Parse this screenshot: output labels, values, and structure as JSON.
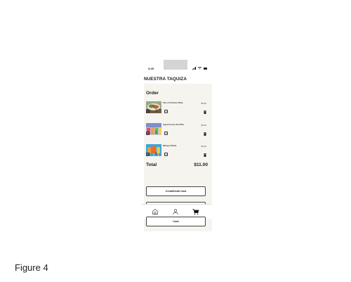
{
  "status_bar": {
    "time": "9:45"
  },
  "app": {
    "title": "NUESTRA TAQUIZA"
  },
  "order": {
    "heading": "Order",
    "items": [
      {
        "name": "Taco Al Pastor Plate",
        "price": "$6.00",
        "quantity": "1",
        "minus": "−",
        "plus": "+"
      },
      {
        "name": "Agua Fresca De Piña",
        "price": "$3.00",
        "quantity": "1",
        "minus": "−",
        "plus": "+"
      },
      {
        "name": "Mango Paleta",
        "price": "$2.00",
        "quantity": "1",
        "minus": "−",
        "plus": "+"
      }
    ],
    "total_label": "Total",
    "total_value": "$11.00"
  },
  "payment": {
    "card_label": "Credit/Debit Card",
    "cash_label": "Cash"
  },
  "tabbar": {
    "items": [
      "home-icon",
      "profile-icon",
      "cart-icon"
    ],
    "active": "cart-icon"
  },
  "caption": "Figure 4",
  "colors": {
    "panel": "#f6f4ef",
    "accent": "#1a1a1a"
  }
}
